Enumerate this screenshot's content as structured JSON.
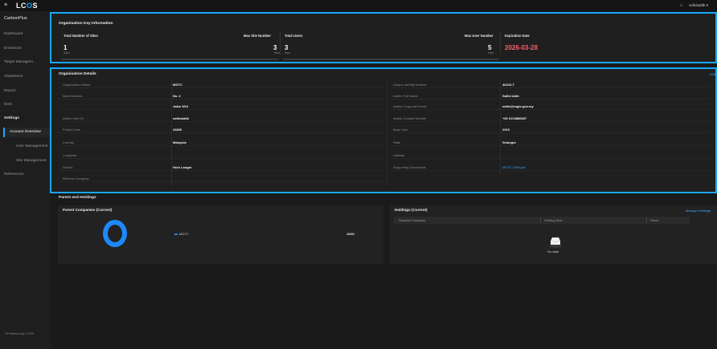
{
  "topbar": {
    "hamburger": "≡",
    "logo_left": "LC",
    "logo_o": "O",
    "logo_right": "S",
    "bell": "⌂",
    "user": "saifuladdb ▾"
  },
  "sidebar": {
    "app_title": "CarbonPlus",
    "items": [
      "Dashboard",
      "Emissions",
      "Target Managem...",
      "Abatement",
      "Report",
      "ESG",
      "Settings"
    ],
    "sub_items": [
      "Account Overview",
      "User Management",
      "Site Management"
    ],
    "references": "References",
    "powered": "©Powered by LCOS"
  },
  "key_info": {
    "title": "Organisation Key Information",
    "total_sites_label": "Total Number of Sites",
    "total_sites_value": "1",
    "total_sites_unit": "Sites",
    "max_site_label": "Max Site Number",
    "max_site_value": "3",
    "max_site_unit": "Sites",
    "total_users_label": "Total Users",
    "total_users_value": "3",
    "total_users_unit": "User",
    "max_user_label": "Max User Number",
    "max_user_value": "5",
    "max_user_unit": "User",
    "expiration_label": "Expiration Date",
    "expiration_value": "2026-03-28"
  },
  "details": {
    "title": "Organisation Details",
    "edit": "Edit",
    "left": [
      {
        "label": "Organisation Name",
        "value": "MGTC"
      },
      {
        "label": "Main Address",
        "value": "No. 2"
      },
      {
        "label": "",
        "value": "Jalan 9/10"
      },
      {
        "label": "Admin User ID",
        "value": "saifuladdb"
      },
      {
        "label": "Postal Code",
        "value": "43650"
      },
      {
        "label": "Country",
        "value": "Malaysia"
      },
      {
        "label": "Longitude",
        "value": ""
      },
      {
        "label": "District",
        "value": "Hulu Langat"
      },
      {
        "label": "Referral Company",
        "value": ""
      }
    ],
    "right": [
      {
        "label": "Unique Identity Number",
        "value": "46223-T"
      },
      {
        "label": "Admin Full Name",
        "value": "Saiful Adib"
      },
      {
        "label": "Admin Corporate Email",
        "value": "saiful@mgtc.gov.my"
      },
      {
        "label": "Admin Contact Number",
        "value": "+60 0123886667"
      },
      {
        "label": "Base Year",
        "value": "2019"
      },
      {
        "label": "State",
        "value": "Selangor"
      },
      {
        "label": "Latitude",
        "value": ""
      },
      {
        "label": "Supporting Documents",
        "value": "MGTC SSM.pdf"
      }
    ]
  },
  "holdings_section": {
    "title": "Parent and Holdings",
    "parent_title": "Parent Companies (Current)",
    "legend_name": "MGTC",
    "legend_pct": "100%",
    "holdings_title": "Holdings (Current)",
    "manage": "Manage Holdings",
    "columns": [
      "Request Company",
      "Holding Size",
      "Since"
    ],
    "no_data": "No data"
  },
  "colors": {
    "accent": "#19a8ff",
    "expiry": "#ff5c6c",
    "donut": "#1e88ff"
  }
}
